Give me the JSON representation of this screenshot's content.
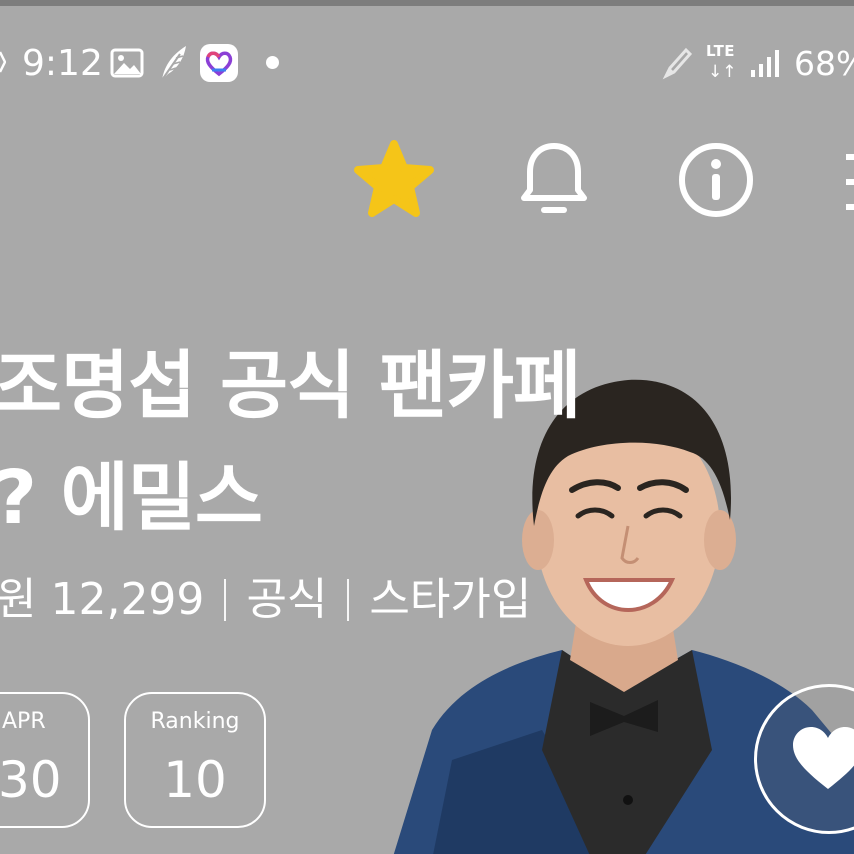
{
  "status_bar": {
    "time": "9:12",
    "network": "LTE",
    "network_arrows": "↓↑",
    "battery": "68%"
  },
  "toolbar": {
    "icons": [
      "star-icon",
      "bell-icon",
      "info-icon",
      "menu-icon"
    ],
    "star_color": "#f5c518"
  },
  "cafe": {
    "title_line1": "조명섭 공식 팬카페",
    "title_line2": "? 에밀스",
    "members_label": "원 12,299",
    "official_label": "공식",
    "join_type_label": "스타가입"
  },
  "stats": {
    "apr_label": "APR",
    "apr_value": "30",
    "ranking_label": "Ranking",
    "ranking_value": "10"
  },
  "like_button": {
    "icon": "heart-icon"
  },
  "colors": {
    "overlay_gray": "#a9a9a9",
    "text": "#ffffff",
    "accent_star": "#f5c518",
    "jacket_blue": "#2a4a7a"
  }
}
